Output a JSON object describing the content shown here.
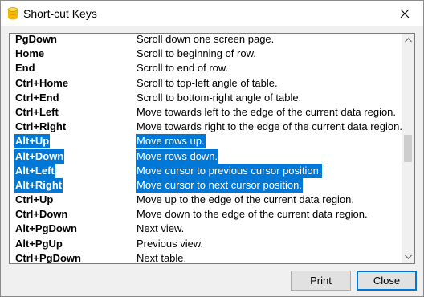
{
  "window": {
    "title": "Short-cut Keys",
    "app_icon": "database-cylinder-icon",
    "close_icon": "close-icon"
  },
  "shortcuts": [
    {
      "key": "PgDown",
      "desc": "Scroll down one screen page.",
      "selected": false
    },
    {
      "key": "Home",
      "desc": "Scroll to beginning of row.",
      "selected": false
    },
    {
      "key": "End",
      "desc": "Scroll to end of row.",
      "selected": false
    },
    {
      "key": "Ctrl+Home",
      "desc": "Scroll to top-left angle of table.",
      "selected": false
    },
    {
      "key": "Ctrl+End",
      "desc": "Scroll to bottom-right angle of table.",
      "selected": false
    },
    {
      "key": "Ctrl+Left",
      "desc": "Move towards left to the edge of the current data region.",
      "selected": false
    },
    {
      "key": "Ctrl+Right",
      "desc": "Move towards right to the edge of the current data region.",
      "selected": false
    },
    {
      "key": "Alt+Up",
      "desc": "Move rows up.",
      "selected": true
    },
    {
      "key": "Alt+Down",
      "desc": "Move rows down.",
      "selected": true
    },
    {
      "key": "Alt+Left",
      "desc": "Move cursor to previous cursor position.",
      "selected": true
    },
    {
      "key": "Alt+Right",
      "desc": "Move cursor to next cursor position.",
      "selected": true
    },
    {
      "key": "Ctrl+Up",
      "desc": "Move up to the edge of the current data region.",
      "selected": false
    },
    {
      "key": "Ctrl+Down",
      "desc": "Move down to the edge of the current data region.",
      "selected": false
    },
    {
      "key": "Alt+PgDown",
      "desc": "Next view.",
      "selected": false
    },
    {
      "key": "Alt+PgUp",
      "desc": "Previous view.",
      "selected": false
    },
    {
      "key": "Ctrl+PgDown",
      "desc": "Next table.",
      "selected": false
    }
  ],
  "buttons": {
    "print_label": "Print",
    "close_label": "Close"
  },
  "colors": {
    "selection": "#0078d7",
    "app_icon": "#f5b800"
  }
}
